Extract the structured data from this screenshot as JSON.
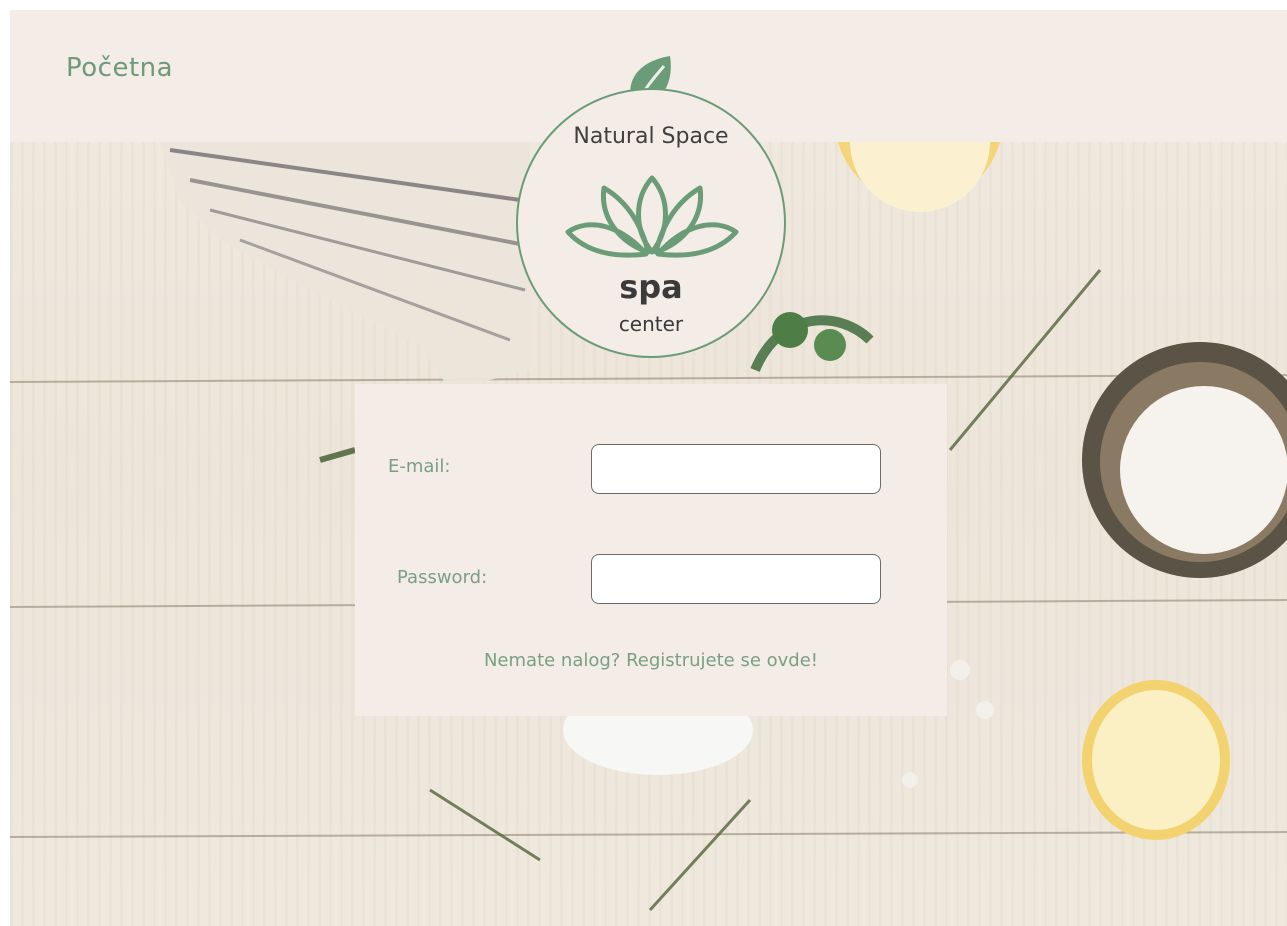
{
  "header": {
    "nav_home_label": "Početna"
  },
  "logo": {
    "title": "Natural Space",
    "spa_text": "spa",
    "center_text": "center",
    "icons": [
      "leaf-icon",
      "lotus-icon"
    ]
  },
  "login": {
    "email_label": "E-mail:",
    "email_value": "",
    "password_label": "Password:",
    "password_value": "",
    "register_link": "Nemate nalog? Registrujete se ovde!"
  },
  "colors": {
    "accent_green": "#6d9b78",
    "panel_background": "#f4ece6",
    "text_dark": "#3a3a3a"
  }
}
